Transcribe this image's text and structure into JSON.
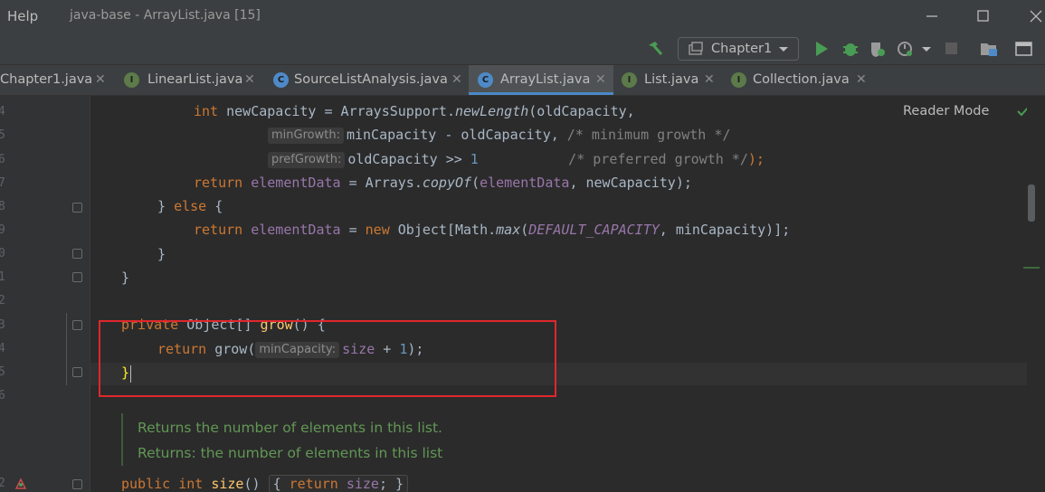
{
  "titlebar": {
    "menu_help": "Help",
    "window_title": "java-base - ArrayList.java [15]"
  },
  "toolbar": {
    "run_config": "Chapter1"
  },
  "tabs": [
    {
      "label": "Chapter1.java",
      "badge": ""
    },
    {
      "label": "LinearList.java",
      "badge": "I"
    },
    {
      "label": "SourceListAnalysis.java",
      "badge": "C"
    },
    {
      "label": "ArrayList.java",
      "badge": "C",
      "active": true
    },
    {
      "label": "List.java",
      "badge": "I"
    },
    {
      "label": "Collection.java",
      "badge": "I"
    }
  ],
  "editor": {
    "reader_mode": "Reader Mode",
    "line_numbers": [
      "4",
      "5",
      "6",
      "7",
      "8",
      "9",
      "0",
      "1",
      "2",
      "3",
      "4",
      "5",
      "6",
      "2"
    ],
    "hints": {
      "min_growth": "minGrowth:",
      "pref_growth": "prefGrowth:",
      "min_capacity": "minCapacity:"
    },
    "lines": {
      "l1_kw": "int",
      "l1_a": " newCapacity = ArraysSupport.",
      "l1_m": "newLength",
      "l1_b": "(oldCapacity,",
      "l2": "minCapacity - oldCapacity, ",
      "l2_c": "/* minimum growth */",
      "l3_a": "oldCapacity >> ",
      "l3_n": "1",
      "l3_c": "/* preferred growth */",
      "l3_e": ");",
      "l4_kw": "return",
      "l4_f": "elementData",
      "l4_a": " = Arrays.",
      "l4_m": "copyOf",
      "l4_b": "(",
      "l4_f2": "elementData",
      "l4_e": ", newCapacity);",
      "l5_a": "} ",
      "l5_kw": "else",
      "l5_b": " {",
      "l6_kw": "return",
      "l6_f": "elementData",
      "l6_a": " = ",
      "l6_kw2": "new",
      "l6_b": " Object[Math.",
      "l6_m": "max",
      "l6_c": "(",
      "l6_const": "DEFAULT_CAPACITY",
      "l6_d": ", minCapacity)];",
      "l7": "}",
      "l8": "}",
      "l9_kw": "private",
      "l9_a": " Object[] ",
      "l9_m": "grow",
      "l9_b": "() {",
      "l10_kw": "return",
      "l10_a": " grow(",
      "l10_b": "size",
      "l10_c": " + ",
      "l10_n": "1",
      "l10_d": ");",
      "l11": "}",
      "l12_kw": "public",
      "l12_kw2": "int",
      "l12_m": "size",
      "l12_a": "() ",
      "l12_fold_a": "{ ",
      "l12_fold_kw": "return",
      "l12_fold_f": "size",
      "l12_fold_b": "; }"
    },
    "doc": {
      "line1": "Returns the number of elements in this list.",
      "line2": "Returns: the number of elements in this list"
    }
  },
  "colors": {
    "background": "#2b2b2b",
    "keyword": "#cc7832",
    "field": "#9876aa",
    "highlight_box": "#e0272d"
  }
}
